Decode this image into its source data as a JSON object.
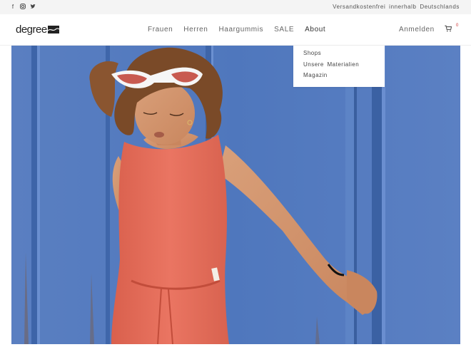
{
  "topbar": {
    "social_icons": [
      "facebook-icon",
      "instagram-icon",
      "twitter-icon"
    ],
    "shipping_note": "Versandkostenfrei innerhalb Deutschlands"
  },
  "header": {
    "logo_text": "degree",
    "nav": [
      {
        "label": "Frauen"
      },
      {
        "label": "Herren"
      },
      {
        "label": "Haargummis"
      },
      {
        "label": "SALE"
      },
      {
        "label": "About"
      }
    ],
    "account_label": "Anmelden",
    "cart_count": "0"
  },
  "dropdown": {
    "items": [
      {
        "label": "Shops"
      },
      {
        "label": "Unsere Materialien"
      },
      {
        "label": "Magazin"
      }
    ]
  },
  "hero": {
    "image": "woman in coral dress leaning against blue metal wall",
    "colors": {
      "wall": "#4e74b8",
      "dress": "#e8735d"
    }
  }
}
